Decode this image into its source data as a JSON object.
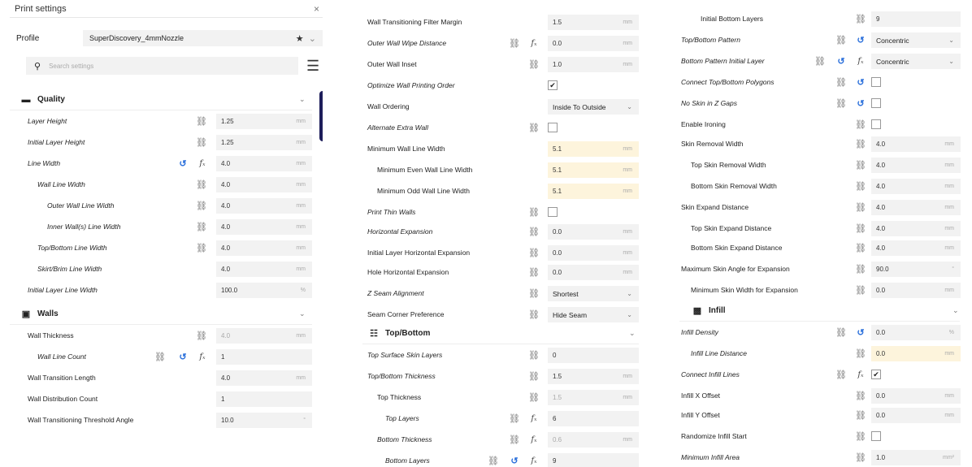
{
  "panel1": {
    "title": "Print settings",
    "close": "×",
    "profile_label": "Profile",
    "profile_value": "SuperDiscovery_4mmNozzle",
    "search_placeholder": "Search settings",
    "quality_title": "Quality",
    "walls_title": "Walls",
    "rows": [
      {
        "label": "Layer Height",
        "value": "1.25",
        "unit": "mm"
      },
      {
        "label": "Initial Layer Height",
        "value": "1.25",
        "unit": "mm"
      },
      {
        "label": "Line Width",
        "value": "4.0",
        "unit": "mm"
      },
      {
        "label": "Wall Line Width",
        "value": "4.0",
        "unit": "mm"
      },
      {
        "label": "Outer Wall Line Width",
        "value": "4.0",
        "unit": "mm"
      },
      {
        "label": "Inner Wall(s) Line Width",
        "value": "4.0",
        "unit": "mm"
      },
      {
        "label": "Top/Bottom Line Width",
        "value": "4.0",
        "unit": "mm"
      },
      {
        "label": "Skirt/Brim Line Width",
        "value": "4.0",
        "unit": "mm"
      },
      {
        "label": "Initial Layer Line Width",
        "value": "100.0",
        "unit": "%"
      },
      {
        "label": "Wall Thickness",
        "value": "4.0",
        "unit": "mm"
      },
      {
        "label": "Wall Line Count",
        "value": "1",
        "unit": ""
      },
      {
        "label": "Wall Transition Length",
        "value": "4.0",
        "unit": "mm"
      },
      {
        "label": "Wall Distribution Count",
        "value": "1",
        "unit": ""
      },
      {
        "label": "Wall Transitioning Threshold Angle",
        "value": "10.0",
        "unit": "°"
      }
    ]
  },
  "panel2": {
    "topbottom_title": "Top/Bottom",
    "rows": [
      {
        "label": "Wall Transitioning Filter Margin",
        "value": "1.5",
        "unit": "mm"
      },
      {
        "label": "Outer Wall Wipe Distance",
        "value": "0.0",
        "unit": "mm"
      },
      {
        "label": "Outer Wall Inset",
        "value": "1.0",
        "unit": "mm"
      },
      {
        "label": "Optimize Wall Printing Order",
        "value": "✔"
      },
      {
        "label": "Wall Ordering",
        "value": "Inside To Outside"
      },
      {
        "label": "Alternate Extra Wall",
        "value": ""
      },
      {
        "label": "Minimum Wall Line Width",
        "value": "5.1",
        "unit": "mm"
      },
      {
        "label": "Minimum Even Wall Line Width",
        "value": "5.1",
        "unit": "mm"
      },
      {
        "label": "Minimum Odd Wall Line Width",
        "value": "5.1",
        "unit": "mm"
      },
      {
        "label": "Print Thin Walls",
        "value": ""
      },
      {
        "label": "Horizontal Expansion",
        "value": "0.0",
        "unit": "mm"
      },
      {
        "label": "Initial Layer Horizontal Expansion",
        "value": "0.0",
        "unit": "mm"
      },
      {
        "label": "Hole Horizontal Expansion",
        "value": "0.0",
        "unit": "mm"
      },
      {
        "label": "Z Seam Alignment",
        "value": "Shortest"
      },
      {
        "label": "Seam Corner Preference",
        "value": "Hide Seam"
      },
      {
        "label": "Top Surface Skin Layers",
        "value": "0",
        "unit": ""
      },
      {
        "label": "Top/Bottom Thickness",
        "value": "1.5",
        "unit": "mm"
      },
      {
        "label": "Top Thickness",
        "value": "1.5",
        "unit": "mm"
      },
      {
        "label": "Top Layers",
        "value": "6",
        "unit": ""
      },
      {
        "label": "Bottom Thickness",
        "value": "0.6",
        "unit": "mm"
      },
      {
        "label": "Bottom Layers",
        "value": "9",
        "unit": ""
      }
    ]
  },
  "panel3": {
    "infill_title": "Infill",
    "rows": [
      {
        "label": "Initial Bottom Layers",
        "value": "9",
        "unit": ""
      },
      {
        "label": "Top/Bottom Pattern",
        "value": "Concentric"
      },
      {
        "label": "Bottom Pattern Initial Layer",
        "value": "Concentric"
      },
      {
        "label": "Connect Top/Bottom Polygons",
        "value": ""
      },
      {
        "label": "No Skin in Z Gaps",
        "value": ""
      },
      {
        "label": "Enable Ironing",
        "value": ""
      },
      {
        "label": "Skin Removal Width",
        "value": "4.0",
        "unit": "mm"
      },
      {
        "label": "Top Skin Removal Width",
        "value": "4.0",
        "unit": "mm"
      },
      {
        "label": "Bottom Skin Removal Width",
        "value": "4.0",
        "unit": "mm"
      },
      {
        "label": "Skin Expand Distance",
        "value": "4.0",
        "unit": "mm"
      },
      {
        "label": "Top Skin Expand Distance",
        "value": "4.0",
        "unit": "mm"
      },
      {
        "label": "Bottom Skin Expand Distance",
        "value": "4.0",
        "unit": "mm"
      },
      {
        "label": "Maximum Skin Angle for Expansion",
        "value": "90.0",
        "unit": "°"
      },
      {
        "label": "Minimum Skin Width for Expansion",
        "value": "0.0",
        "unit": "mm"
      },
      {
        "label": "Infill Density",
        "value": "0.0",
        "unit": "%"
      },
      {
        "label": "Infill Line Distance",
        "value": "0.0",
        "unit": "mm"
      },
      {
        "label": "Connect Infill Lines",
        "value": "✔"
      },
      {
        "label": "Infill X Offset",
        "value": "0.0",
        "unit": "mm"
      },
      {
        "label": "Infill Y Offset",
        "value": "0.0",
        "unit": "mm"
      },
      {
        "label": "Randomize Infill Start",
        "value": ""
      },
      {
        "label": "Minimum Infill Area",
        "value": "1.0",
        "unit": "mm²"
      }
    ]
  },
  "icons": {
    "link": "⛓",
    "reset": "↺",
    "fx": "fₓ",
    "chevron": "⌄",
    "search": "⚲",
    "menu": "☰",
    "star": "★"
  }
}
